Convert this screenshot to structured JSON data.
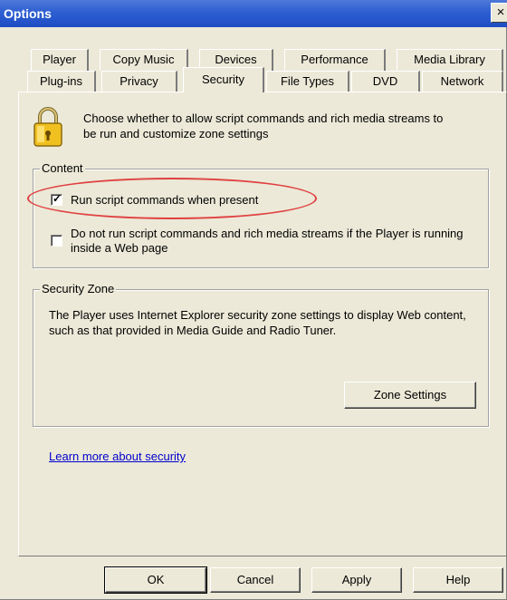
{
  "window": {
    "title": "Options",
    "close_glyph": "×"
  },
  "tabs": {
    "row1": [
      "Player",
      "Copy Music",
      "Devices",
      "Performance",
      "Media Library"
    ],
    "row2": [
      "Plug-ins",
      "Privacy",
      "Security",
      "File Types",
      "DVD",
      "Network"
    ],
    "active": "Security"
  },
  "security": {
    "icon": "lock-icon",
    "description": "Choose whether to allow script commands and rich media streams to be run and customize zone settings"
  },
  "content_group": {
    "label": "Content",
    "options": [
      {
        "label": "Run script commands when present",
        "checked": true
      },
      {
        "label": "Do not run script commands and rich media streams if the Player is running inside a Web page",
        "checked": false
      }
    ],
    "check_glyph": "✓"
  },
  "zone_group": {
    "label": "Security Zone",
    "text": "The Player uses Internet Explorer security zone settings to display Web content, such as that provided in Media Guide and Radio Tuner.",
    "button": "Zone Settings"
  },
  "link": "Learn more about security",
  "buttons": {
    "ok": "OK",
    "cancel": "Cancel",
    "apply": "Apply",
    "help": "Help"
  },
  "colors": {
    "highlight": "#e04040",
    "link": "#0000cc",
    "titlebar": "#2d5fd2"
  }
}
